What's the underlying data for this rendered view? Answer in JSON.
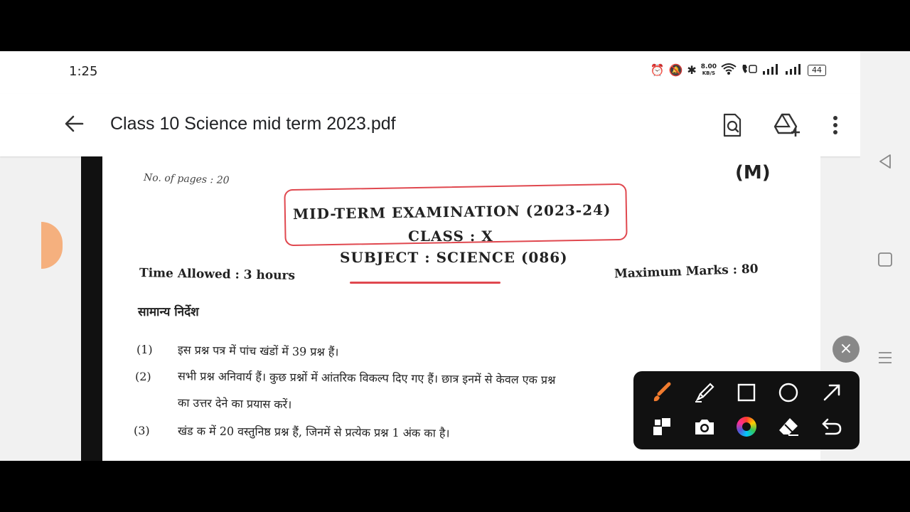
{
  "status_bar": {
    "time": "1:25",
    "net_speed_value": "8.00",
    "net_speed_unit": "KB/S",
    "battery": "44",
    "icons": [
      "alarm-icon",
      "mute-icon",
      "bluetooth-icon",
      "wifi-icon",
      "volte-icon",
      "signal-icon",
      "signal-icon",
      "battery-icon"
    ]
  },
  "app_bar": {
    "title": "Class 10 Science mid term 2023.pdf",
    "actions": [
      "search-in-document-icon",
      "add-to-drive-icon",
      "more-options-icon"
    ]
  },
  "document": {
    "pages_label": "No. of pages : 20",
    "set_code": "(M)",
    "exam_title": "MID-TERM EXAMINATION (2023-24)",
    "class_line": "CLASS : X",
    "subject_line": "SUBJECT : SCIENCE (086)",
    "time_allowed": "Time Allowed : 3 hours",
    "max_marks": "Maximum Marks : 80",
    "instructions_heading": "सामान्य निर्देश",
    "instructions": [
      {
        "num": "(1)",
        "text": "इस प्रश्न पत्र में पांच खंडों में 39 प्रश्न हैं।"
      },
      {
        "num": "(2)",
        "text": "सभी प्रश्न अनिवार्य हैं। कुछ प्रश्नों में आंतरिक विकल्प दिए गए हैं। छात्र इनमें से केवल एक प्रश्न"
      },
      {
        "num": "",
        "text": "का उत्तर देने का प्रयास करें।"
      },
      {
        "num": "(3)",
        "text": "खंड क में 20 वस्तुनिष्ठ प्रश्न हैं, जिनमें से प्रत्येक प्रश्न 1 अंक का है।"
      }
    ]
  },
  "annotation_toolbar": {
    "close": "×",
    "row1": [
      "brush-icon",
      "highlighter-icon",
      "rectangle-icon",
      "circle-icon",
      "arrow-icon"
    ],
    "row2": [
      "mosaic-icon",
      "camera-icon",
      "color-wheel-icon",
      "eraser-icon",
      "undo-icon"
    ]
  },
  "nav_bar": [
    "back-triangle-icon",
    "home-square-icon",
    "menu-lines-icon"
  ],
  "colors": {
    "annotation_red": "#e0484f",
    "brush_orange": "#f07b2e"
  }
}
